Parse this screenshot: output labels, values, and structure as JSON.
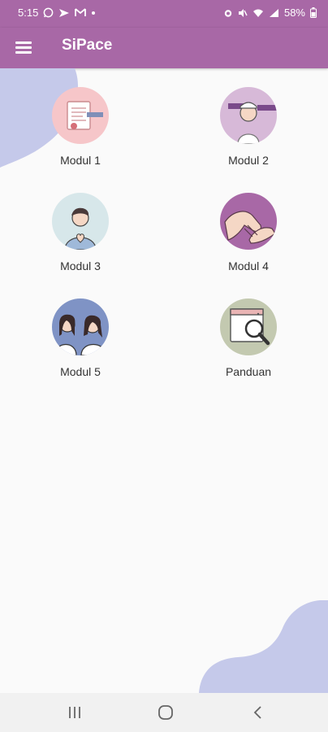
{
  "status": {
    "time": "5:15",
    "battery": "58%",
    "icons_left": [
      "whatsapp-icon",
      "send-icon",
      "gmail-icon",
      "dot-icon"
    ],
    "icons_right": [
      "alarm-icon",
      "mute-icon",
      "wifi-icon",
      "signal-icon",
      "battery-icon"
    ]
  },
  "appbar": {
    "title": "SiPace",
    "menu_icon": "hamburger-menu-icon"
  },
  "colors": {
    "primary": "#a868a6",
    "blob": "#c5c9ea",
    "background": "#fafafa"
  },
  "modules": [
    {
      "label": "Modul 1",
      "icon": "scroll-icon",
      "bg": "#f6c6c9"
    },
    {
      "label": "Modul 2",
      "icon": "nurse-icon",
      "bg": "#d7b9d8"
    },
    {
      "label": "Modul 3",
      "icon": "person-heart-icon",
      "bg": "#d7e7ea"
    },
    {
      "label": "Modul 4",
      "icon": "holding-hands-icon",
      "bg": "#a868a6"
    },
    {
      "label": "Modul 5",
      "icon": "friends-icon",
      "bg": "#7f93c5"
    },
    {
      "label": "Panduan",
      "icon": "magnifier-browser-icon",
      "bg": "#c3c9b0"
    }
  ],
  "navbar": {
    "icons": [
      "recent-apps-icon",
      "home-icon",
      "back-icon"
    ]
  }
}
